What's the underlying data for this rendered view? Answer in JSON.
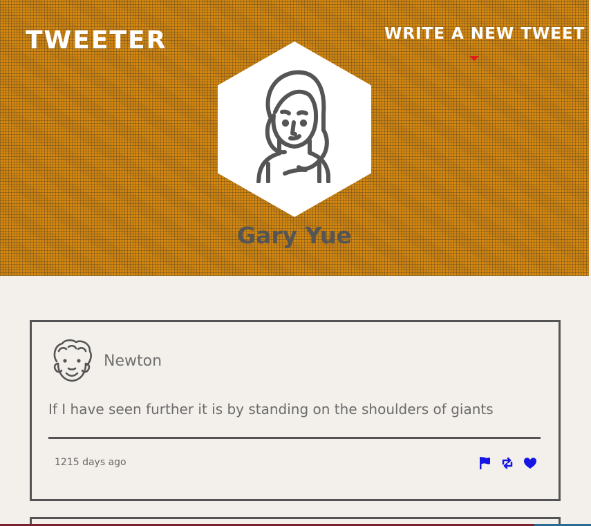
{
  "header": {
    "brand": "TWEETER",
    "compose_link": "WRITE A NEW TWEET",
    "profile_name": "Gary Yue"
  },
  "tweets": [
    {
      "author": "Newton",
      "content": "If I have seen further it is by standing on the shoulders of giants",
      "time": "1215 days ago",
      "actions": [
        {
          "icon": "flag-icon"
        },
        {
          "icon": "retweet-icon"
        },
        {
          "icon": "heart-icon"
        }
      ]
    }
  ],
  "colors": {
    "accent": "#d5870f",
    "action_icon": "#1616e4",
    "caret": "#e51b1b",
    "card_border": "#545454"
  }
}
